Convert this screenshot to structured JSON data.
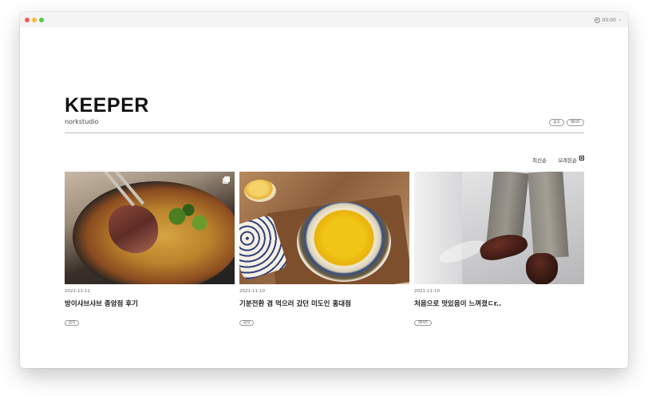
{
  "window": {
    "status_text": "00:00"
  },
  "blog": {
    "title": "KEEPER",
    "subtitle": "norkstudio",
    "categories": [
      "음식",
      "데이트"
    ]
  },
  "sort": {
    "options": [
      "최신순",
      "오래된순"
    ]
  },
  "posts": [
    {
      "date": "2021-11-11",
      "title": "방이샤브샤브 종암점 후기",
      "tag": "음식"
    },
    {
      "date": "2021-11-10",
      "title": "기분전환 겸 먹으러 갔던 미도인 홍대점",
      "tag": "음식"
    },
    {
      "date": "2021-11-10",
      "title": "처음으로 멋있음이 느껴졌ㄷr..",
      "tag": "데이트"
    }
  ],
  "colors": {
    "accent": "#111111",
    "rule": "#bdbdbd"
  }
}
